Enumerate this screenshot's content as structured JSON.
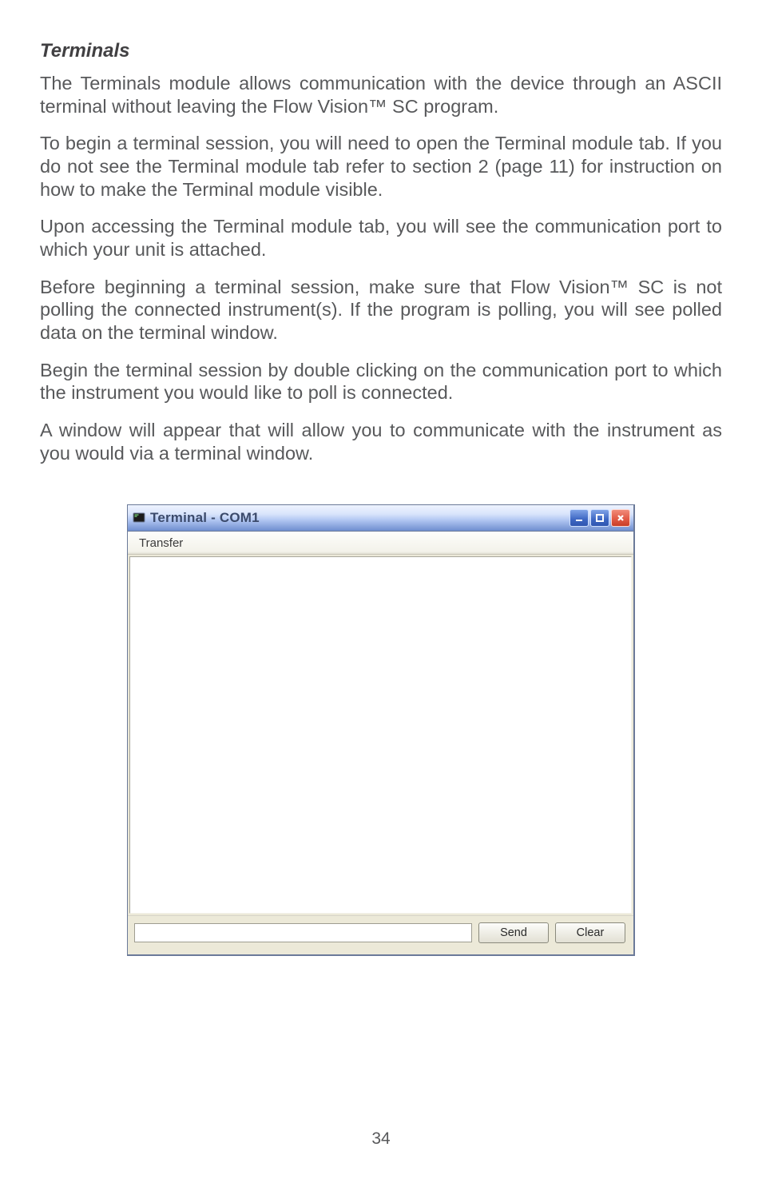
{
  "section_title": "Terminals",
  "paragraphs": [
    "The Terminals module allows communication with the device through an ASCII terminal without leaving the Flow Vision™ SC program.",
    "To begin a terminal session, you will need to open the Terminal module tab. If you do not see the Terminal module tab refer to section 2 (page 11) for instruction on how to make the Terminal module visible.",
    "Upon accessing the Terminal module tab, you will see the communication port to which your unit is attached.",
    "Before beginning a terminal session, make sure that Flow Vision™ SC is not polling the connected instrument(s). If the program is polling, you will see polled data on the terminal window.",
    "Begin the terminal session by double clicking on the communication port to which the instrument you would like to poll is connected.",
    "A window will appear that will allow you to communicate with the instrument as you would via a terminal window."
  ],
  "window": {
    "title": "Terminal - COM1",
    "menu": {
      "transfer": "Transfer"
    },
    "buttons": {
      "send": "Send",
      "clear": "Clear"
    },
    "input_value": ""
  },
  "page_number": "34"
}
